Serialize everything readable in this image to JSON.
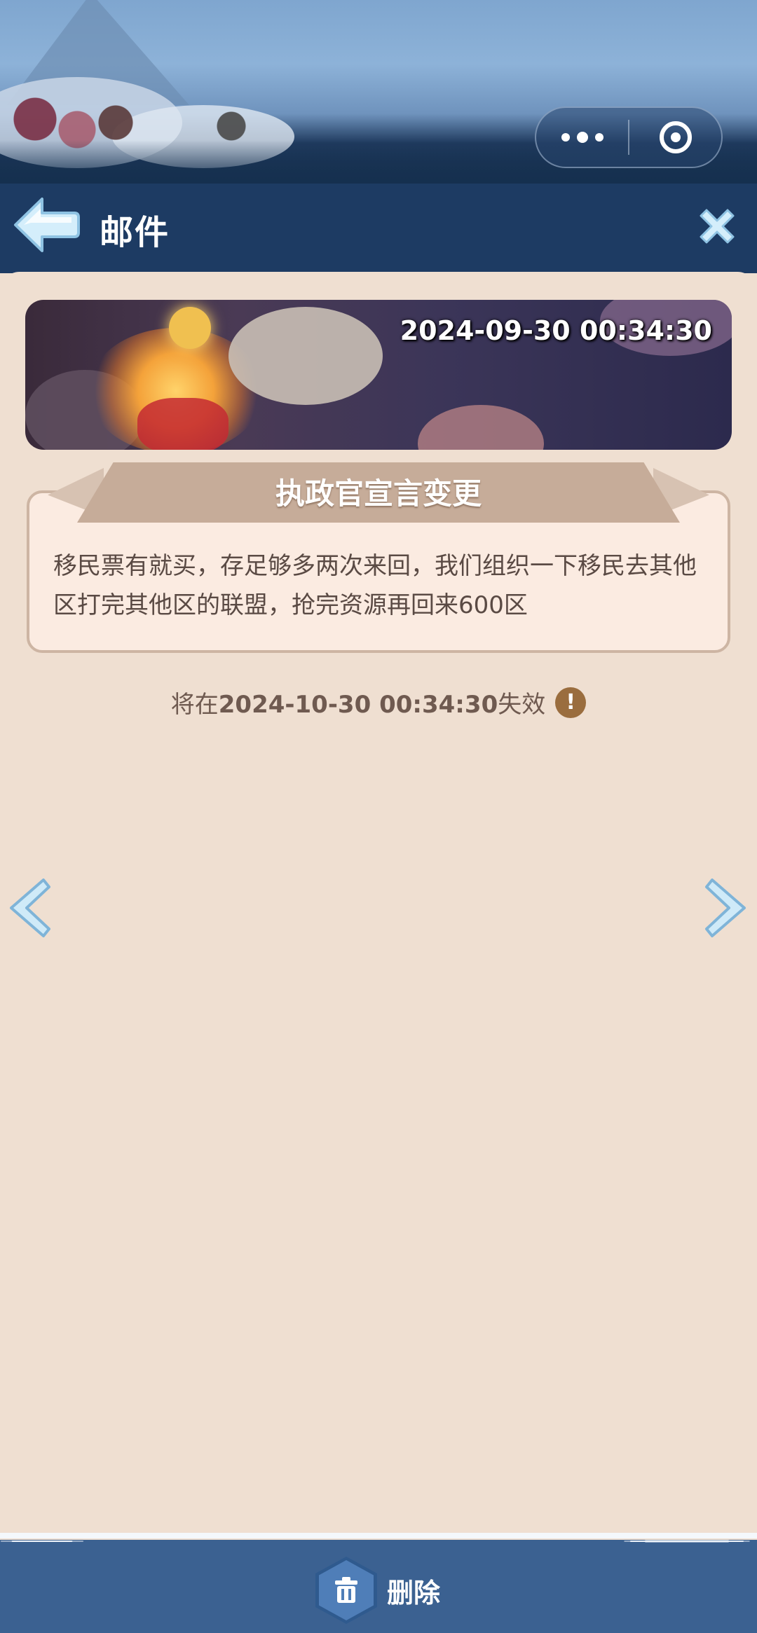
{
  "header": {
    "title": "邮件"
  },
  "mail": {
    "sent_time": "2024-09-30 00:34:30",
    "subject": "执政官宣言变更",
    "body": "移民票有就买，存足够多两次来回，我们组织一下移民去其他区打完其他区的联盟，抢完资源再回来600区",
    "expiry_prefix": "将在",
    "expiry_time": "2024-10-30 00:34:30",
    "expiry_suffix": "失效"
  },
  "footer": {
    "delete_label": "删除"
  },
  "icons": {
    "back": "back-arrow-icon",
    "close": "close-icon",
    "more": "more-dots-icon",
    "exit": "target-circle-icon",
    "warning": "exclamation-icon",
    "prev": "chevron-left-icon",
    "next": "chevron-right-icon",
    "delete": "trash-icon"
  },
  "colors": {
    "header": "#1d3b63",
    "paper": "#efdfd1",
    "footer": "#3b6191",
    "accent_ice": "#cfeaf8"
  }
}
